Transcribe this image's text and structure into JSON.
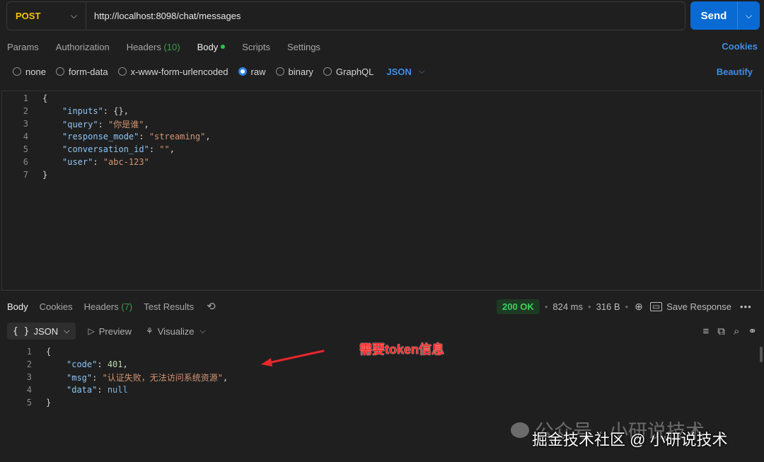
{
  "request": {
    "method": "POST",
    "url": "http://localhost:8098/chat/messages",
    "send_label": "Send"
  },
  "request_tabs": [
    {
      "label": "Params"
    },
    {
      "label": "Authorization"
    },
    {
      "label": "Headers",
      "count": "(10)"
    },
    {
      "label": "Body",
      "active": true
    },
    {
      "label": "Scripts"
    },
    {
      "label": "Settings"
    }
  ],
  "cookies_label": "Cookies",
  "body_types": {
    "none": "none",
    "form_data": "form-data",
    "urlencoded": "x-www-form-urlencoded",
    "raw": "raw",
    "binary": "binary",
    "graphql": "GraphQL",
    "selected": "raw",
    "format": "JSON"
  },
  "beautify_label": "Beautify",
  "request_body": {
    "line_numbers": [
      "1",
      "2",
      "3",
      "4",
      "5",
      "6",
      "7"
    ],
    "open": "{",
    "close": "}",
    "fields": [
      {
        "key": "\"inputs\"",
        "value": "{}",
        "comma": ","
      },
      {
        "key": "\"query\"",
        "value": "\"你是谁\"",
        "comma": ","
      },
      {
        "key": "\"response_mode\"",
        "value": "\"streaming\"",
        "comma": ","
      },
      {
        "key": "\"conversation_id\"",
        "value": "\"\"",
        "comma": ","
      },
      {
        "key": "\"user\"",
        "value": "\"abc-123\"",
        "comma": ""
      }
    ]
  },
  "response_tabs": {
    "body": "Body",
    "cookies": "Cookies",
    "headers": "Headers",
    "headers_count": "(7)",
    "test_results": "Test Results"
  },
  "response_meta": {
    "status": "200 OK",
    "time": "824 ms",
    "size": "316 B",
    "save_label": "Save Response",
    "more": "•••"
  },
  "view_bar": {
    "format": "JSON",
    "preview": "Preview",
    "visualize": "Visualize"
  },
  "response_body": {
    "line_numbers": [
      "1",
      "2",
      "3",
      "4",
      "5"
    ],
    "open": "{",
    "close": "}",
    "code_key": "\"code\"",
    "code_val": "401",
    "msg_key": "\"msg\"",
    "msg_val": "\"认证失败，无法访问系统资源\"",
    "data_key": "\"data\"",
    "data_val": "null"
  },
  "annotation": "需要token信息",
  "watermark": {
    "line1": "公众号 · 小研说技术",
    "line2": "掘金技术社区 @ 小研说技术"
  },
  "colors": {
    "accent": "#0a6ad3",
    "link": "#3e8ee8",
    "method": "#f5c400",
    "status_ok": "#3fd160",
    "annotation": "#ff2a2a"
  },
  "icons": [
    "chevron-down-icon",
    "history-icon",
    "globe-icon",
    "save-icon",
    "preview-icon",
    "visualize-icon",
    "wrap-icon",
    "copy-icon",
    "search-icon",
    "link-icon",
    "arrow-annotation"
  ]
}
